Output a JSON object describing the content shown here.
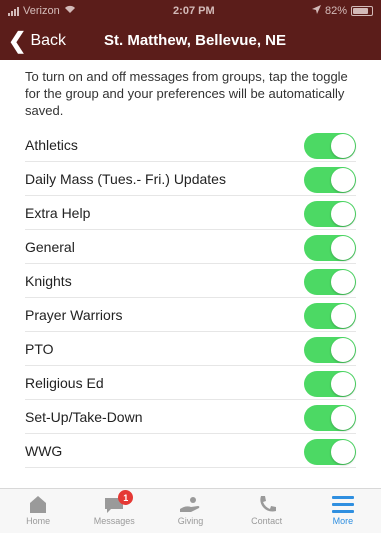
{
  "status_bar": {
    "carrier": "Verizon",
    "time": "2:07 PM",
    "battery": "82%",
    "battery_level": 0.82
  },
  "nav": {
    "back_label": "Back",
    "title": "St. Matthew, Bellevue, NE"
  },
  "intro_text": "To turn on and off messages from groups, tap the toggle for the group and your preferences will be automatically saved.",
  "groups": [
    {
      "label": "Athletics",
      "enabled": true
    },
    {
      "label": "Daily Mass (Tues.- Fri.) Updates",
      "enabled": true
    },
    {
      "label": "Extra Help",
      "enabled": true
    },
    {
      "label": "General",
      "enabled": true
    },
    {
      "label": "Knights",
      "enabled": true
    },
    {
      "label": "Prayer Warriors",
      "enabled": true
    },
    {
      "label": "PTO",
      "enabled": true
    },
    {
      "label": "Religious Ed",
      "enabled": true
    },
    {
      "label": "Set-Up/Take-Down",
      "enabled": true
    },
    {
      "label": "WWG",
      "enabled": true
    }
  ],
  "tab_bar": {
    "tabs": [
      {
        "label": "Home",
        "icon": "home-icon"
      },
      {
        "label": "Messages",
        "icon": "messages-icon",
        "badge": "1"
      },
      {
        "label": "Giving",
        "icon": "giving-icon"
      },
      {
        "label": "Contact",
        "icon": "phone-icon"
      },
      {
        "label": "More",
        "icon": "menu-icon",
        "active": true
      }
    ]
  },
  "colors": {
    "header": "#5b1d1a",
    "toggle_on": "#4cd964",
    "active_tab": "#2f8fe0",
    "badge": "#e53935"
  }
}
